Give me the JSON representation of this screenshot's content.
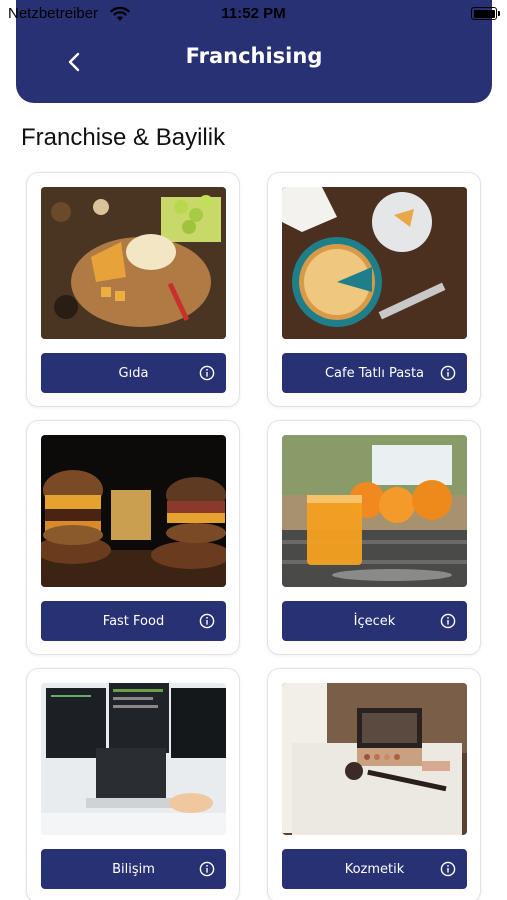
{
  "status_bar": {
    "carrier": "Netzbetreiber",
    "time": "11:52 PM"
  },
  "header": {
    "title": "Franchising",
    "back_icon": "chevron-left-icon"
  },
  "section": {
    "title": "Franchise & Bayilik"
  },
  "categories": [
    {
      "label": "Gıda",
      "image": "food-platter"
    },
    {
      "label": "Cafe Tatlı Pasta",
      "image": "cheesecake"
    },
    {
      "label": "Fast Food",
      "image": "burgers-fries"
    },
    {
      "label": "İçecek",
      "image": "orange-juice"
    },
    {
      "label": "Bilişim",
      "image": "computers"
    },
    {
      "label": "Kozmetik",
      "image": "cosmetics"
    }
  ],
  "colors": {
    "primary": "#283174",
    "background": "#ffffff"
  }
}
